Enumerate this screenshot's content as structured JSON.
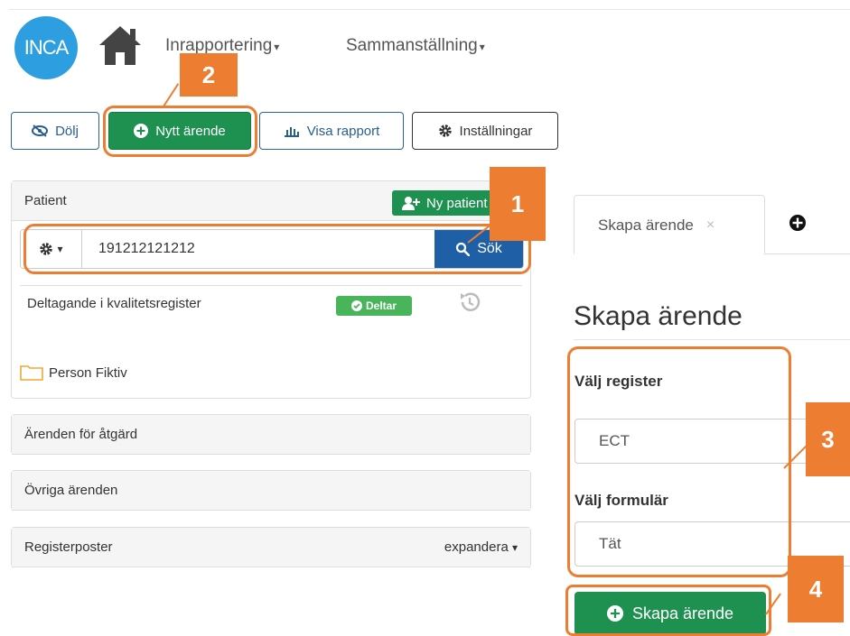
{
  "app": {
    "logo_text": "INCA"
  },
  "nav": {
    "item1_label": "Inrapportering",
    "item2_label": "Sammanställning",
    "caret": "▾"
  },
  "toolbar": {
    "hide_label": "Dölj",
    "new_case_label": "Nytt ärende",
    "report_label": "Visa rapport",
    "settings_label": "Inställningar"
  },
  "patient_panel": {
    "title": "Patient",
    "new_patient_label": "Ny patient",
    "search_value": "191212121212",
    "search_button_label": "Sök",
    "participation_label": "Deltagande i kvalitetsregister",
    "participation_badge": "Deltar",
    "person_name": "Person Fiktiv"
  },
  "panels": {
    "actions_title": "Ärenden för åtgärd",
    "other_title": "Övriga ärenden",
    "registry_title": "Registerposter",
    "expand_label": "expandera"
  },
  "right": {
    "tab_label": "Skapa ärende",
    "tab_close": "×",
    "heading": "Skapa ärende",
    "register_label": "Välj register",
    "register_value": "ECT",
    "form_label": "Välj formulär",
    "form_value": "Tät",
    "create_button_label": "Skapa ärende"
  },
  "callouts": {
    "b1": "1",
    "b2": "2",
    "b3": "3",
    "b4": "4"
  },
  "colors": {
    "accent_orange": "#ed7d31",
    "success_green": "#1e9151",
    "primary_blue": "#1f5fa6",
    "logo_blue": "#2d9fe0"
  }
}
